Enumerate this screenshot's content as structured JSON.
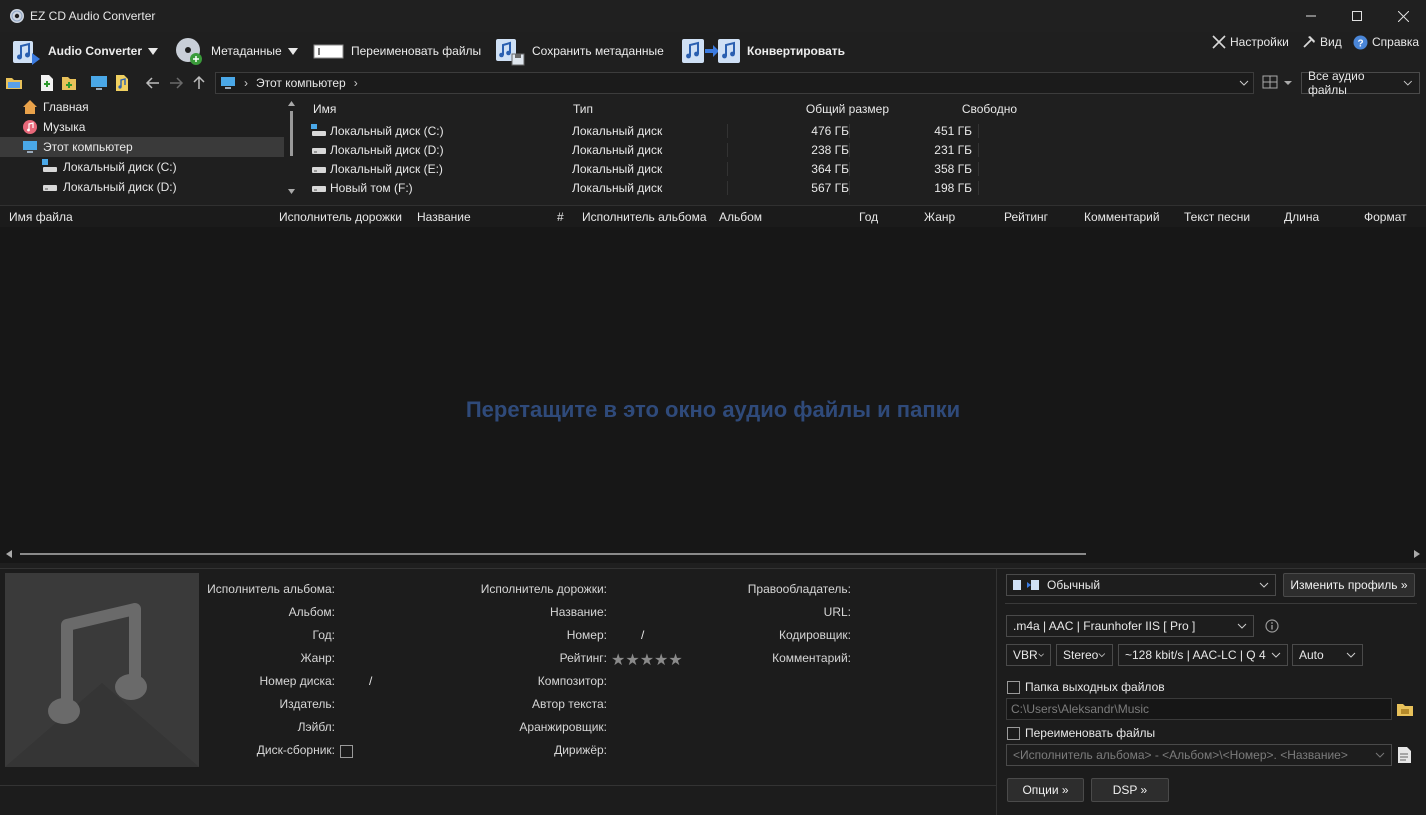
{
  "window": {
    "title": "EZ CD Audio Converter",
    "minimize": "minimize",
    "maximize": "maximize",
    "close": "close"
  },
  "toolbar": {
    "audio_converter": "Audio Converter",
    "metadata": "Метаданные",
    "rename_files": "Переименовать файлы",
    "save_metadata": "Сохранить метаданные",
    "convert": "Конвертировать",
    "settings": "Настройки",
    "view": "Вид",
    "help": "Справка"
  },
  "nav": {
    "address": "Этот компьютер",
    "filter": "Все аудио файлы"
  },
  "tree": [
    {
      "label": "Главная",
      "icon": "home-icon"
    },
    {
      "label": "Музыка",
      "icon": "music-folder-icon"
    },
    {
      "label": "Этот компьютер",
      "icon": "computer-icon"
    },
    {
      "label": "Локальный диск (C:)",
      "icon": "system-drive-icon"
    },
    {
      "label": "Локальный диск (D:)",
      "icon": "drive-icon"
    }
  ],
  "drives": {
    "headers": [
      "Имя",
      "Тип",
      "Общий размер",
      "Свободно"
    ],
    "rows": [
      [
        "Локальный диск (C:)",
        "Локальный диск",
        "476 ГБ",
        "451 ГБ"
      ],
      [
        "Локальный диск (D:)",
        "Локальный диск",
        "238 ГБ",
        "231 ГБ"
      ],
      [
        "Локальный диск (E:)",
        "Локальный диск",
        "364 ГБ",
        "358 ГБ"
      ],
      [
        "Новый том (F:)",
        "Локальный диск",
        "567 ГБ",
        "198 ГБ"
      ]
    ]
  },
  "filelist": {
    "headers": [
      "Имя файла",
      "Исполнитель дорожки",
      "Название",
      "#",
      "Исполнитель альбома",
      "Альбом",
      "Год",
      "Жанр",
      "Рейтинг",
      "Комментарий",
      "Текст песни",
      "Длина",
      "Формат"
    ],
    "drop_hint": "Перетащите в это окно аудио файлы и папки"
  },
  "meta": {
    "col1": [
      "Исполнитель альбома:",
      "Альбом:",
      "Год:",
      "Жанр:",
      "Номер диска:",
      "Издатель:",
      "Лэйбл:",
      "Диск-сборник:"
    ],
    "col2": [
      "Исполнитель дорожки:",
      "Название:",
      "Номер:",
      "Рейтинг:",
      "Композитор:",
      "Автор текста:",
      "Аранжировщик:",
      "Дирижёр:"
    ],
    "col3": [
      "Правообладатель:",
      "URL:",
      "Кодировщик:",
      "Комментарий:"
    ],
    "slash": "/",
    "stars": "★★★★★"
  },
  "profile": {
    "name": "Обычный",
    "change_profile": "Изменить профиль »",
    "codec": ".m4a  |  AAC  |  Fraunhofer IIS [ Pro ]",
    "mode": "VBR",
    "channels": "Stereo",
    "quality": "~128 kbit/s | AAC-LC | Q 4",
    "samplerate": "Auto",
    "output_folder_label": "Папка выходных файлов",
    "output_folder": "C:\\Users\\Aleksandr\\Music",
    "rename_label": "Переименовать файлы",
    "rename_pattern": "<Исполнитель альбома> - <Альбом>\\<Номер>. <Название>",
    "options": "Опции »",
    "dsp": "DSP »"
  }
}
